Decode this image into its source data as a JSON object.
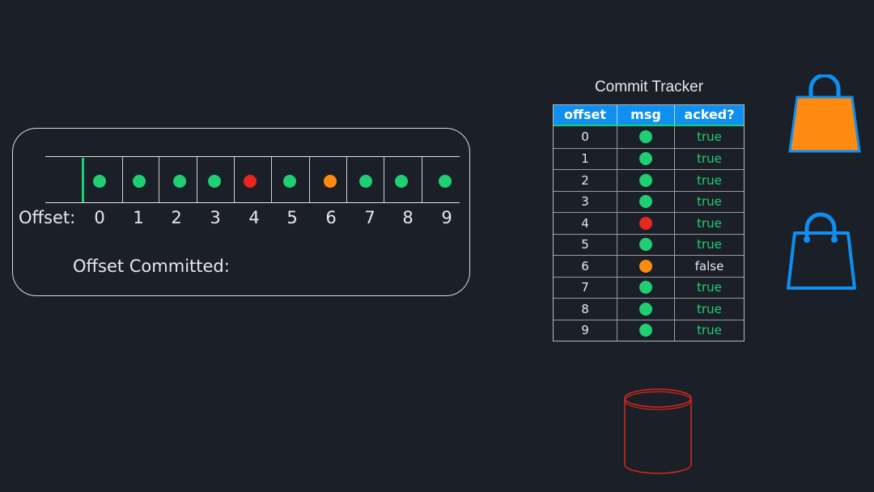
{
  "colors": {
    "background": "#1b2028",
    "ok": "#1fcf72",
    "error": "#e8281c",
    "pending": "#ff8a10",
    "header": "#0f8ff0",
    "database": "#d8281c"
  },
  "log": {
    "offset_label": "Offset:",
    "committed_label": "Offset Committed:",
    "messages": [
      {
        "offset": "0",
        "status": "ok"
      },
      {
        "offset": "1",
        "status": "ok"
      },
      {
        "offset": "2",
        "status": "ok"
      },
      {
        "offset": "3",
        "status": "ok"
      },
      {
        "offset": "4",
        "status": "error"
      },
      {
        "offset": "5",
        "status": "ok"
      },
      {
        "offset": "6",
        "status": "pending"
      },
      {
        "offset": "7",
        "status": "ok"
      },
      {
        "offset": "8",
        "status": "ok"
      },
      {
        "offset": "9",
        "status": "ok"
      }
    ]
  },
  "tracker": {
    "title": "Commit Tracker",
    "columns": [
      "offset",
      "msg",
      "acked?"
    ],
    "rows": [
      {
        "offset": "0",
        "status": "ok",
        "acked": "true"
      },
      {
        "offset": "1",
        "status": "ok",
        "acked": "true"
      },
      {
        "offset": "2",
        "status": "ok",
        "acked": "true"
      },
      {
        "offset": "3",
        "status": "ok",
        "acked": "true"
      },
      {
        "offset": "4",
        "status": "error",
        "acked": "true"
      },
      {
        "offset": "5",
        "status": "ok",
        "acked": "true"
      },
      {
        "offset": "6",
        "status": "pending",
        "acked": "false"
      },
      {
        "offset": "7",
        "status": "ok",
        "acked": "true"
      },
      {
        "offset": "8",
        "status": "ok",
        "acked": "true"
      },
      {
        "offset": "9",
        "status": "ok",
        "acked": "true"
      }
    ]
  },
  "icons": [
    "shopping-bag-filled-icon",
    "shopping-bag-outline-icon",
    "database-icon"
  ]
}
